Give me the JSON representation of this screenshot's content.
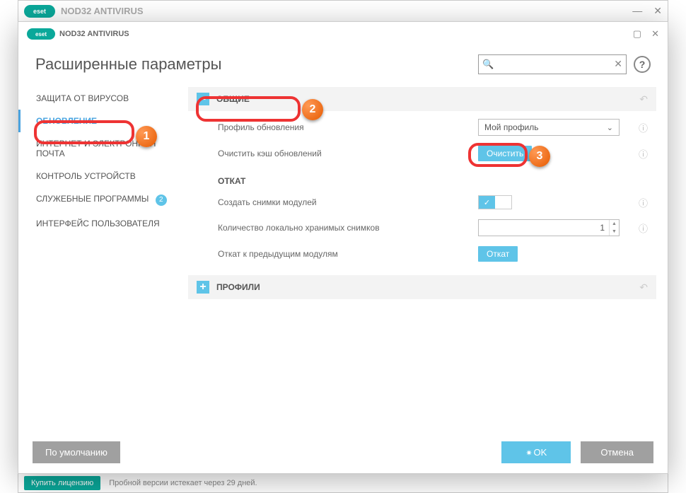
{
  "brand": {
    "logo_text": "eset",
    "product": "NOD32 ANTIVIRUS"
  },
  "dialog": {
    "title": "Расширенные параметры",
    "search_placeholder": "",
    "sidebar": [
      {
        "label": "ЗАЩИТА ОТ ВИРУСОВ",
        "active": false
      },
      {
        "label": "ОБНОВЛЕНИЕ",
        "active": true
      },
      {
        "label": "ИНТЕРНЕТ И ЭЛЕКТРОННАЯ ПОЧТА",
        "active": false
      },
      {
        "label": "КОНТРОЛЬ УСТРОЙСТВ",
        "active": false
      },
      {
        "label": "СЛУЖЕБНЫЕ ПРОГРАММЫ",
        "active": false,
        "badge": "2"
      },
      {
        "label": "ИНТЕРФЕЙС ПОЛЬЗОВАТЕЛЯ",
        "active": false
      }
    ],
    "sections": {
      "general": {
        "title": "ОБЩИЕ",
        "profile_label": "Профиль обновления",
        "profile_value": "Мой профиль",
        "clear_cache_label": "Очистить кэш обновлений",
        "clear_btn": "Очистить"
      },
      "rollback": {
        "title": "ОТКАТ",
        "snapshots_label": "Создать снимки модулей",
        "snapshots_on": true,
        "count_label": "Количество локально хранимых снимков",
        "count_value": "1",
        "rollback_label": "Откат к предыдущим модулям",
        "rollback_btn": "Откат"
      },
      "profiles": {
        "title": "ПРОФИЛИ"
      }
    },
    "footer": {
      "default_btn": "По умолчанию",
      "ok_btn": "OK",
      "cancel_btn": "Отмена"
    }
  },
  "outer": {
    "buy_btn": "Купить лицензию",
    "trial_text": "Пробной версии истекает через 29 дней."
  },
  "callouts": {
    "n1": "1",
    "n2": "2",
    "n3": "3"
  }
}
